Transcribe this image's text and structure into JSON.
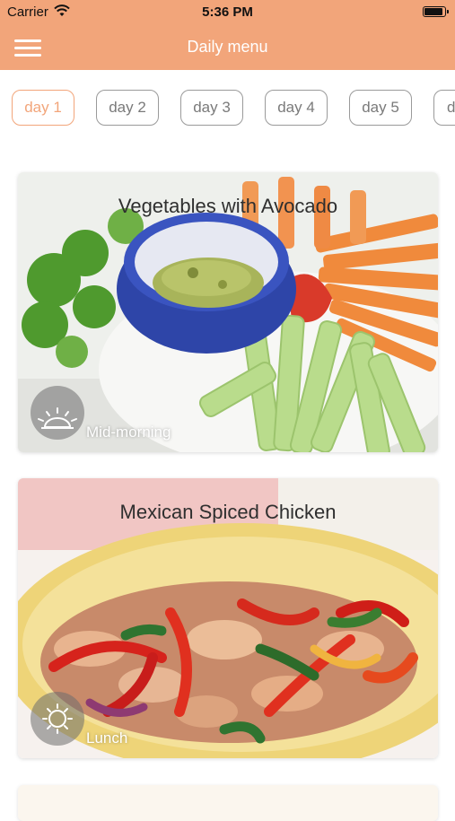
{
  "status_bar": {
    "carrier": "Carrier",
    "time": "5:36 PM"
  },
  "nav": {
    "title": "Daily menu",
    "menu_icon": "hamburger-menu-icon"
  },
  "tabs": [
    {
      "label": "day 1",
      "active": true
    },
    {
      "label": "day 2",
      "active": false
    },
    {
      "label": "day 3",
      "active": false
    },
    {
      "label": "day 4",
      "active": false
    },
    {
      "label": "day 5",
      "active": false
    },
    {
      "label": "d",
      "active": false
    }
  ],
  "meals": [
    {
      "title": "Vegetables with Avocado",
      "time_label": "Mid-morning",
      "time_icon": "sunrise-icon"
    },
    {
      "title": "Mexican Spiced Chicken",
      "time_label": "Lunch",
      "time_icon": "sun-icon"
    }
  ],
  "colors": {
    "accent": "#f2a57a",
    "tab_border": "#9a9a9a",
    "tab_text": "#7a7a7a"
  }
}
